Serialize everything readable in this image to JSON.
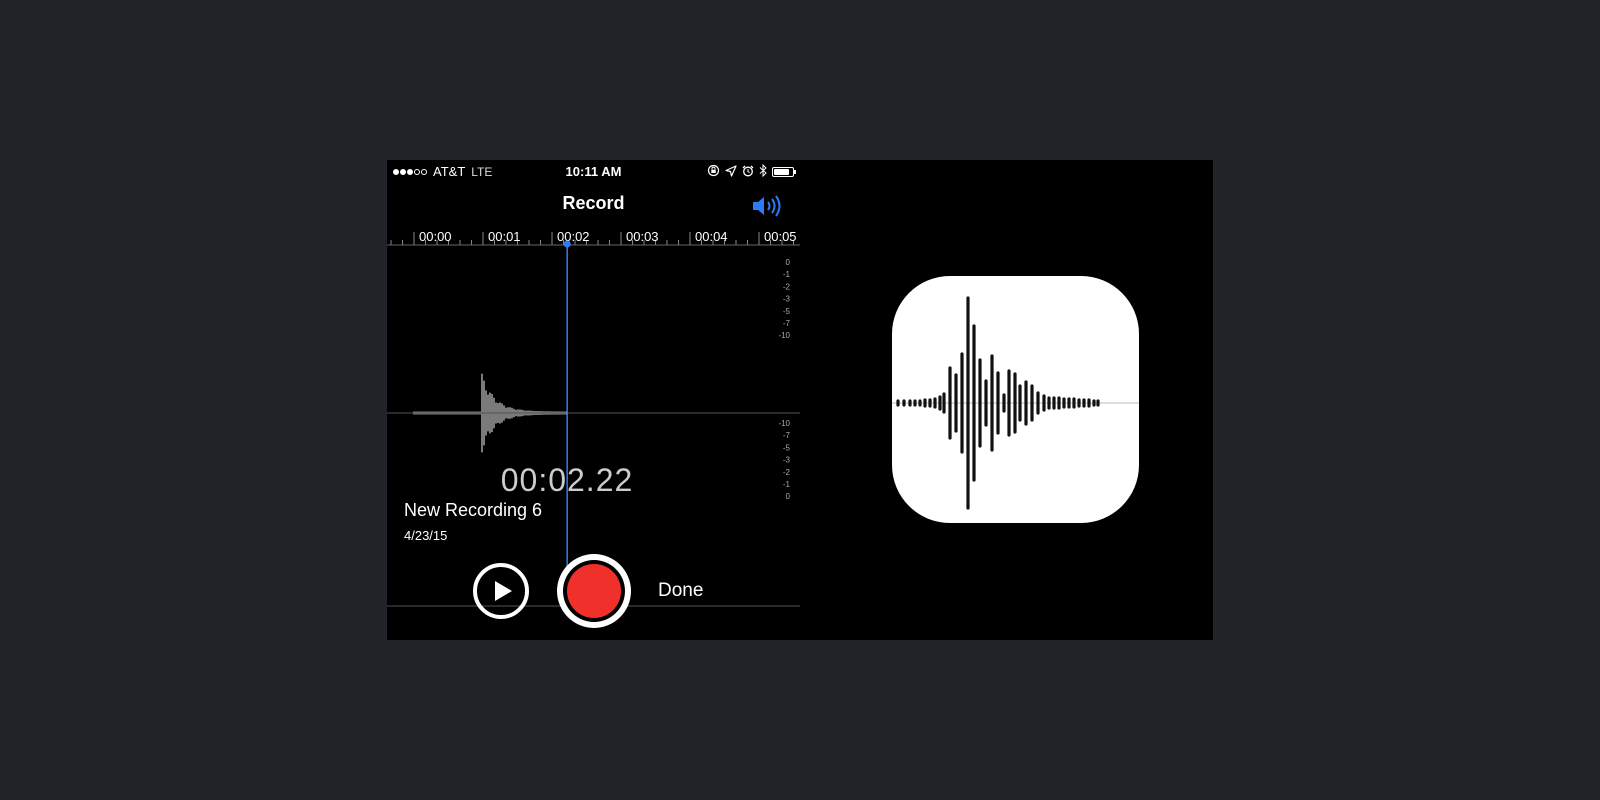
{
  "status_bar": {
    "signal_full": 3,
    "signal_total": 5,
    "carrier": "AT&T",
    "network": "LTE",
    "time": "10:11 AM",
    "battery_level": 0.85,
    "icons": [
      "orientation-lock-icon",
      "location-icon",
      "alarm-icon",
      "bluetooth-icon",
      "battery-icon"
    ]
  },
  "header": {
    "title": "Record",
    "speaker_icon": "speaker-icon",
    "accent_color": "#2d7cf6"
  },
  "timeline": {
    "ticks": [
      "00:00",
      "00:01",
      "00:02",
      "00:03",
      "00:04",
      "00:05"
    ],
    "playhead_seconds": 2.22,
    "db_scale_top": [
      "0",
      "-1",
      "-2",
      "-3",
      "-5",
      "-7",
      "-10"
    ],
    "db_scale_bottom": [
      "-10",
      "-7",
      "-5",
      "-3",
      "-2",
      "-1",
      "0"
    ]
  },
  "recording": {
    "elapsed": "00:02.22",
    "name": "New Recording 6",
    "date": "4/23/15"
  },
  "controls": {
    "play_icon": "play-icon",
    "record_color": "#f0302a",
    "done_label": "Done"
  },
  "app_icon": {
    "name": "voice-memos-app-icon"
  }
}
